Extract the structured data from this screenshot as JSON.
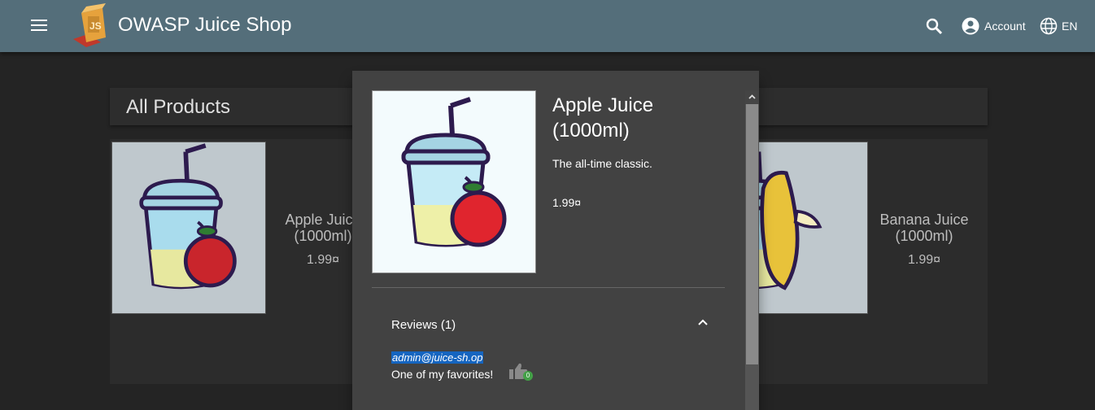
{
  "app": {
    "title": "OWASP Juice Shop"
  },
  "toolbar": {
    "menu_icon": "menu-icon",
    "search_icon": "search-icon",
    "account_label": "Account",
    "account_icon": "account-circle-icon",
    "language_label": "EN",
    "language_icon": "globe-icon"
  },
  "page": {
    "heading": "All Products"
  },
  "products": [
    {
      "name": "Apple Juice (1000ml)",
      "price": "1.99¤"
    },
    {
      "name": "Banana Juice (1000ml)",
      "price": "1.99¤"
    }
  ],
  "dialog": {
    "name": "Apple Juice (1000ml)",
    "description": "The all-time classic.",
    "price": "1.99¤",
    "reviews_title": "Reviews (1)",
    "review": {
      "author": "admin@juice-sh.op",
      "text": "One of my favorites!",
      "likes": "0"
    }
  },
  "colors": {
    "toolbar": "#546e7a",
    "dialog": "#424242",
    "background": "#303030",
    "accent": "#1565c0"
  }
}
